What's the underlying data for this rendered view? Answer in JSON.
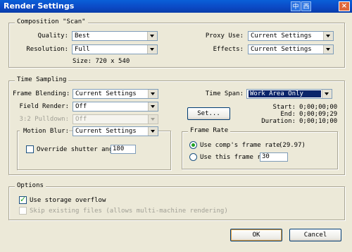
{
  "window": {
    "title": "Render Settings",
    "ime": [
      "中",
      "西"
    ],
    "close_label": "×"
  },
  "composition": {
    "group_title": "Composition \"Scan\"",
    "quality_label": "Quality:",
    "quality_value": "Best",
    "resolution_label": "Resolution:",
    "resolution_value": "Full",
    "size_text": "Size: 720 x 540",
    "proxy_label": "Proxy Use:",
    "proxy_value": "Current Settings",
    "effects_label": "Effects:",
    "effects_value": "Current Settings"
  },
  "time_sampling": {
    "group_title": "Time Sampling",
    "frame_blending_label": "Frame Blending:",
    "frame_blending_value": "Current Settings",
    "field_render_label": "Field Render:",
    "field_render_value": "Off",
    "pulldown_label": "3:2 Pulldown:",
    "pulldown_value": "Off",
    "motion_blur_label": "Motion Blur:",
    "motion_blur_value": "Current Settings",
    "override_label": "Override shutter angl",
    "override_value": "180",
    "time_span_label": "Time Span:",
    "time_span_value": "Work Area Only",
    "set_button": "Set...",
    "start_label": "Start:",
    "start_value": "0;00;00;00",
    "end_label": "End:",
    "end_value": "0;00;09;29",
    "duration_label": "Duration:",
    "duration_value": "0;00;10;00",
    "frame_rate": {
      "group_title": "Frame Rate",
      "use_comp_label": "Use comp's frame rate",
      "use_comp_value": "(29.97)",
      "use_this_label": "Use this frame rat",
      "use_this_value": "30"
    }
  },
  "options": {
    "group_title": "Options",
    "storage_overflow_label": "Use storage overflow",
    "skip_existing_label": "Skip existing files (allows multi-machine rendering)"
  },
  "buttons": {
    "ok": "OK",
    "cancel": "Cancel"
  }
}
